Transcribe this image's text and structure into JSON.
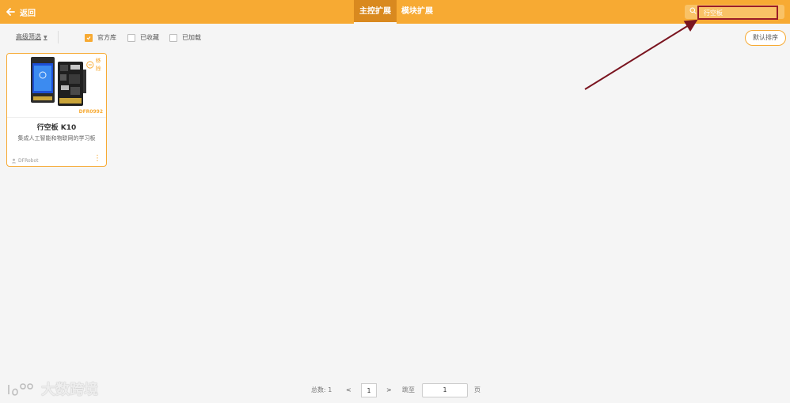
{
  "header": {
    "back_label": "返回",
    "tabs": [
      {
        "label": "主控扩展",
        "active": true
      },
      {
        "label": "模块扩展",
        "active": false
      }
    ],
    "search_value": "行空板",
    "accent_color": "#f7aa33",
    "highlight_color": "#9b1c27"
  },
  "filters": {
    "advanced_label": "高级筛选",
    "checkboxes": [
      {
        "label": "官方库",
        "checked": true
      },
      {
        "label": "已收藏",
        "checked": false
      },
      {
        "label": "已加载",
        "checked": false
      }
    ],
    "sort_label": "默认排序"
  },
  "cards": [
    {
      "title": "行空板 K10",
      "description": "集成人工智能和物联网的学习板",
      "sku": "DFR0992",
      "remove_label": "移除",
      "author": "DFRobot"
    }
  ],
  "pagination": {
    "total_label": "总数:",
    "total": "1",
    "prev": "<",
    "current": "1",
    "next": ">",
    "jump_label": "跳至",
    "jump_value": "1",
    "page_suffix": "页"
  },
  "watermark": "大数跨境"
}
